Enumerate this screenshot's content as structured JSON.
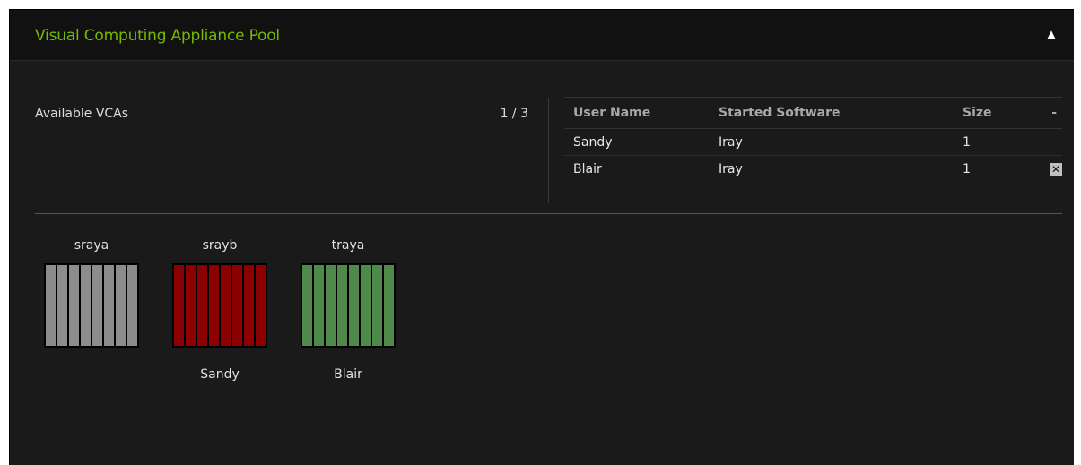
{
  "panel": {
    "title": "Visual Computing Appliance Pool",
    "collapse_icon": "▲"
  },
  "summary": {
    "label": "Available VCAs",
    "count": "1 / 3"
  },
  "table": {
    "headers": [
      "User Name",
      "Started Software",
      "Size",
      "-"
    ],
    "rows": [
      {
        "user": "Sandy",
        "software": "Iray",
        "size": "1",
        "action": ""
      },
      {
        "user": "Blair",
        "software": "Iray",
        "size": "1",
        "action": "✕"
      }
    ]
  },
  "nodes": [
    {
      "name": "sraya",
      "user": "",
      "color": "#8c8c8c",
      "slots": 8
    },
    {
      "name": "srayb",
      "user": "Sandy",
      "color": "#8b0000",
      "slots": 8
    },
    {
      "name": "traya",
      "user": "Blair",
      "color": "#4f8a4a",
      "slots": 8
    }
  ],
  "colors": {
    "accent": "#76b900",
    "background": "#1a1a1a",
    "header": "#111111"
  }
}
